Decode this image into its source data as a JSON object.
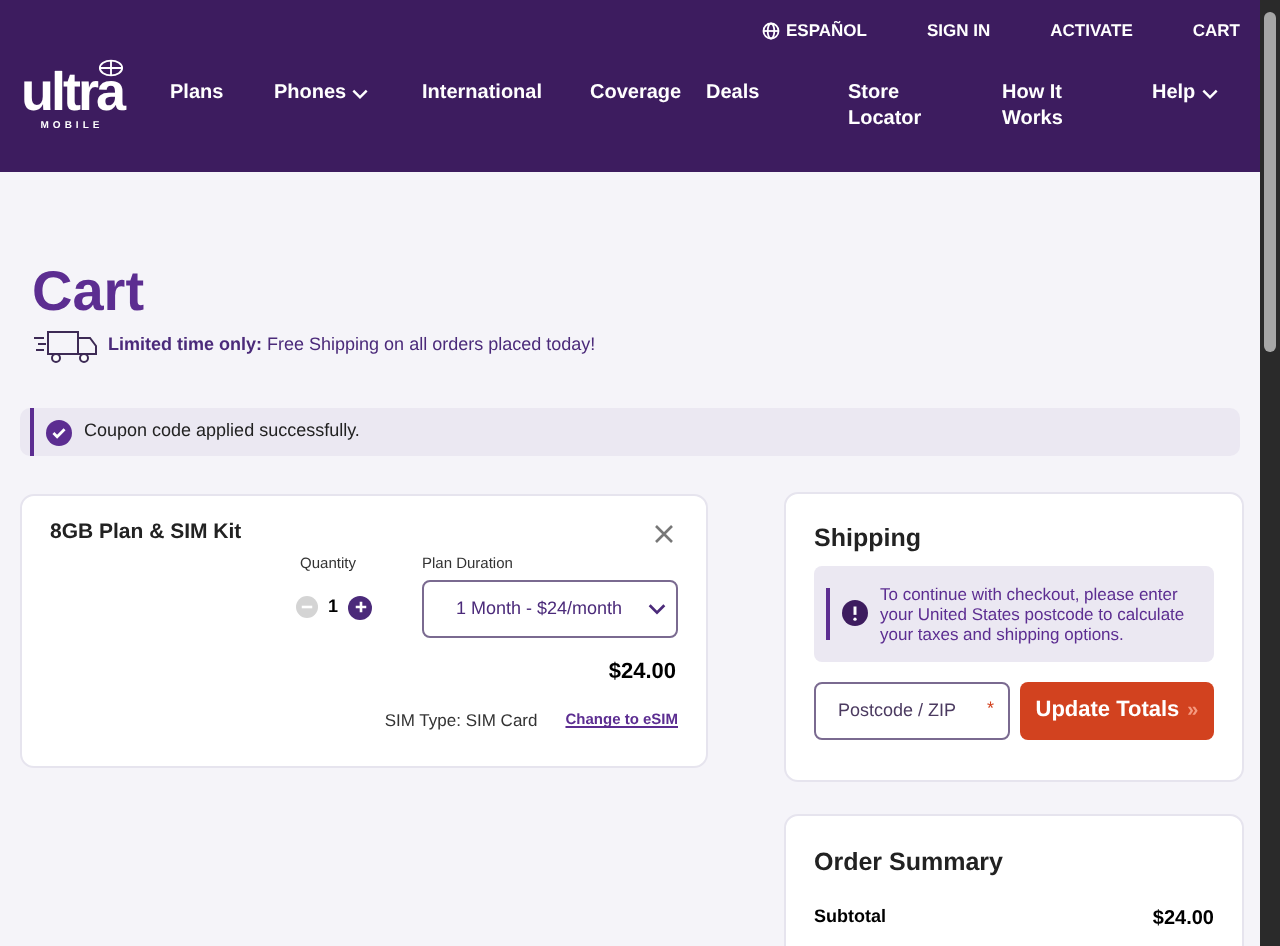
{
  "header": {
    "logo": {
      "word": "ultra",
      "sub": "MOBILE"
    },
    "utility_links": [
      {
        "label": "ESPAÑOL",
        "kind": "language"
      },
      {
        "label": "SIGN IN",
        "kind": "link"
      },
      {
        "label": "ACTIVATE",
        "kind": "link"
      },
      {
        "label": "CART",
        "kind": "link"
      }
    ],
    "nav": [
      {
        "label": "Plans",
        "dropdown": false
      },
      {
        "label": "Phones",
        "dropdown": true
      },
      {
        "label": "International",
        "dropdown": false
      },
      {
        "label": "Coverage",
        "dropdown": false
      },
      {
        "label": "Deals",
        "dropdown": false
      },
      {
        "label": "Store Locator",
        "dropdown": false
      },
      {
        "label": "How It Works",
        "dropdown": false
      },
      {
        "label": "Help",
        "dropdown": true
      }
    ]
  },
  "page_title": "Cart",
  "promo": "**Limited time only:** Free Shipping on all orders placed today!",
  "coupon_message": "Coupon code applied successfully.",
  "cart_item": {
    "name": "8GB Plan & SIM Kit",
    "quantity_label": "Quantity",
    "quantity": "1",
    "decrease_disabled": true,
    "duration_label": "Plan Duration",
    "duration": "1 Month - $24/month",
    "price": "$24.00",
    "sim_type_label": "SIM Type:",
    "sim_type": "SIM Card",
    "change_link": "Change to eSIM"
  },
  "shipping": {
    "title": "Shipping",
    "notice": "To continue with checkout, please enter your United States postcode to calculate your taxes and shipping options.",
    "postcode": {
      "placeholder": "Postcode / ZIP",
      "required_mark": "*"
    },
    "button": "Update Totals",
    "button_arrow": "»"
  },
  "order_summary": {
    "title": "Order Summary",
    "rows": [
      {
        "label": "Subtotal",
        "value": "$24.00"
      }
    ]
  }
}
